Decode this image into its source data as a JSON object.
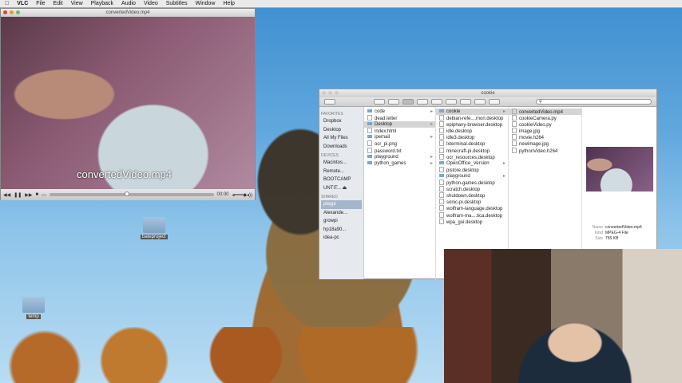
{
  "menubar": {
    "app": "VLC",
    "items": [
      "File",
      "Edit",
      "View",
      "Playback",
      "Audio",
      "Video",
      "Subtitles",
      "Window",
      "Help"
    ]
  },
  "vlc": {
    "title": "convertedVideo.mp4",
    "caption": "convertedVideo.mp4",
    "time": "00:00",
    "progress_percent": 46
  },
  "desktop": {
    "icons": [
      "bateproject",
      "temp"
    ]
  },
  "finder": {
    "title": "cookie",
    "search_placeholder": "",
    "sidebar": {
      "favorites_header": "FAVORITES",
      "favorites": [
        "Dropbox",
        "Desktop",
        "All My Files",
        "Downloads"
      ],
      "devices_header": "DEVICES",
      "devices": [
        "Macintos...",
        "Remote...",
        "BOOTCAMP",
        "UNTIT... ⏏"
      ],
      "shared_header": "SHARED",
      "shared": [
        "playpi",
        "Alexande...",
        "growpi",
        "hp18a90...",
        "idea-pc"
      ]
    },
    "col1": [
      "code",
      "dead.letter",
      "Desktop",
      "index.html",
      "ipemail",
      "ocr_pi.png",
      "password.txt",
      "playground",
      "python_games"
    ],
    "col2": [
      "cookie",
      "debian-refe....mon.desktop",
      "epiphany-browser.desktop",
      "idle.desktop",
      "idle3.desktop",
      "lxterminal.desktop",
      "minecraft-pi.desktop",
      "ocr_resources.desktop",
      "OpenOffice_Version",
      "pistore.desktop",
      "playground",
      "python-games.desktop",
      "scratch.desktop",
      "shutdown.desktop",
      "sonic-pi.desktop",
      "wolfram-language.desktop",
      "wolfram-ma....tica.desktop",
      "wpa_gui.desktop"
    ],
    "col3": [
      "convertedVideo.mp4",
      "cookieCamera.py",
      "cookieVideo.py",
      "image.jpg",
      "movie.h264",
      "newimage.jpg",
      "pythonVideo.h264"
    ],
    "info": {
      "name_label": "Name",
      "name": "convertedVideo.mp4",
      "kind_label": "Kind",
      "kind": "MPEG-4 File",
      "size_label": "Size",
      "size": "755 KB"
    }
  }
}
